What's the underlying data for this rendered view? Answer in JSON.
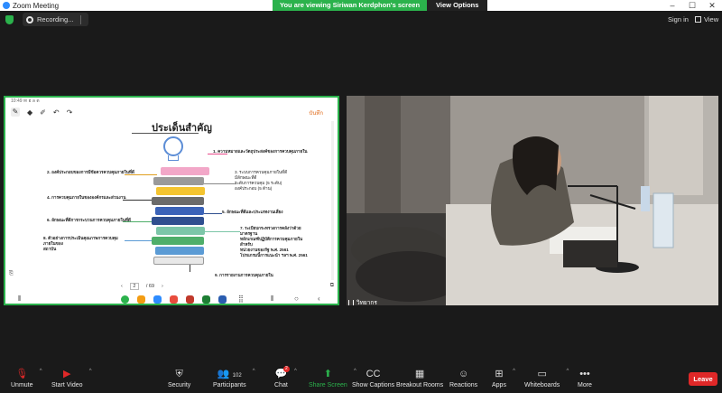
{
  "window": {
    "title": "Zoom Meeting",
    "controls": [
      "–",
      "☐",
      "✕"
    ]
  },
  "share_banner": {
    "message": "You are viewing Siriwan Kerdphon's screen",
    "view_options": "View Options"
  },
  "topbar": {
    "recording_label": "Recording...",
    "sign_in": "Sign in",
    "view": "View"
  },
  "shared_screen": {
    "status_time": "10:49  ✉ ฮ ล ต",
    "orange_text": "บันทึก",
    "slide": {
      "title": "ประเด็นสำคัญ",
      "items": [
        {
          "side": "right",
          "text": "1. ความหมายและวัตถุประสงค์ของการควบคุมภายใน"
        },
        {
          "side": "left",
          "text": "2. องค์ประกอบของการมีข้อควรควบคุมภายในที่ดี"
        },
        {
          "side": "right",
          "text": "3. ระบบการควบคุมภายในที่ดี\nมีลักษณะที่ดี\nระดับการควบคุม (5 ระดับ)\nองค์ประกอบ (5 ด้าน)"
        },
        {
          "side": "left",
          "text": "4. การควบคุมภายในขององค์กรและส่วนงาน"
        },
        {
          "side": "right",
          "text": "5. ลักษณะที่ดีและประเภทงานเสี่ยง"
        },
        {
          "side": "left",
          "text": "6. ลักษณะที่ดีการกระบวนการควบคุมภายในที่ดี"
        },
        {
          "side": "right",
          "text": "7. ระเบียบกระทรวงการคลังว่าด้วยมาตรฐาน\nหลักเกณฑ์ปฏิบัติการควบคุมภายในสำหรับ\nหน่วยงานของรัฐ พ.ศ. 2561\nโปรแกรมนี้การแนะนำ ฯลฯ พ.ศ. 2561"
        },
        {
          "side": "left",
          "text": "8. ตัวอย่างการประเมินคุณภาพการควบคุมภายในของ\nสถาบัน"
        },
        {
          "side": "right",
          "text": "9. การรายงานการควบคุมภายใน"
        }
      ],
      "page_current": "2",
      "page_total": "/ 69"
    }
  },
  "video": {
    "participant_name": "วิทยากร"
  },
  "controls": {
    "unmute": "Unmute",
    "start_video": "Start Video",
    "security": "Security",
    "participants": "Participants",
    "participants_count": "102",
    "chat": "Chat",
    "chat_badge": "2",
    "share_screen": "Share Screen",
    "show_captions": "Show Captions",
    "breakout_rooms": "Breakout Rooms",
    "reactions": "Reactions",
    "apps": "Apps",
    "whiteboards": "Whiteboards",
    "more": "More",
    "leave": "Leave"
  },
  "colors": {
    "accent_green": "#2bb24c",
    "leave_red": "#e02828",
    "zoom_blue": "#2d8cff"
  }
}
